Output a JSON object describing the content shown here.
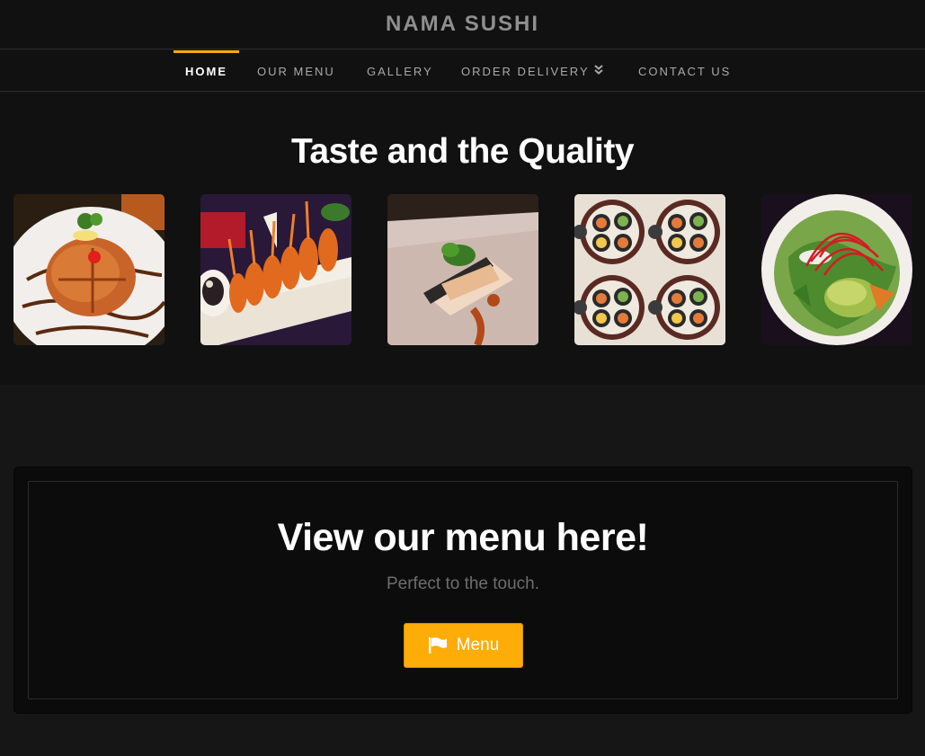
{
  "brand": {
    "name": "NAMA SUSHI"
  },
  "nav": {
    "items": [
      {
        "label": "HOME",
        "active": true
      },
      {
        "label": "OUR MENU"
      },
      {
        "label": "GALLERY"
      },
      {
        "label": "ORDER DELIVERY",
        "icon": "double-chevron-down-icon"
      },
      {
        "label": "CONTACT US"
      }
    ],
    "accent_color": "#f7a90d"
  },
  "hero": {
    "title": "Taste and the Quality",
    "gallery": [
      {
        "icon": "katsu-plate-photo"
      },
      {
        "icon": "tempura-shrimp-photo"
      },
      {
        "icon": "nigiri-plate-photo"
      },
      {
        "icon": "sushi-rolls-collage-photo"
      },
      {
        "icon": "salad-bowl-photo"
      }
    ]
  },
  "cta": {
    "title": "View our menu here!",
    "subtitle": "Perfect to the touch.",
    "button_label": "Menu",
    "button_icon": "flag-icon",
    "button_color": "#fdac08"
  }
}
